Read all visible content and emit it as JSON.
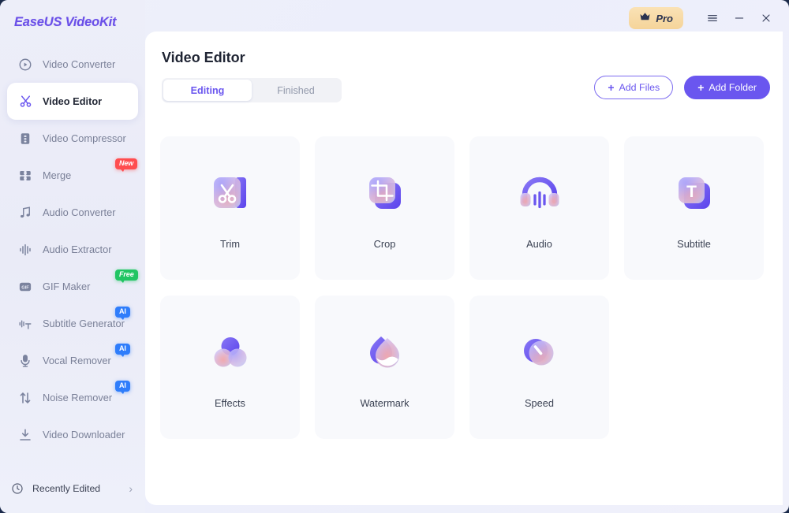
{
  "app": {
    "logo": "EaseUS VideoKit"
  },
  "titlebar": {
    "pro_label": "Pro",
    "crown_icon": "crown-icon",
    "menu_icon": "hamburger-menu-icon",
    "minimize_icon": "minimize-icon",
    "close_icon": "close-icon"
  },
  "sidebar": {
    "items": [
      {
        "label": "Video Converter",
        "icon": "play-circle-icon",
        "active": false,
        "badge": null
      },
      {
        "label": "Video Editor",
        "icon": "scissors-icon",
        "active": true,
        "badge": null
      },
      {
        "label": "Video Compressor",
        "icon": "compress-icon",
        "active": false,
        "badge": null
      },
      {
        "label": "Merge",
        "icon": "merge-grid-icon",
        "active": false,
        "badge": {
          "text": "New",
          "color": "#ff4d4f",
          "kind": "new"
        }
      },
      {
        "label": "Audio Converter",
        "icon": "music-note-icon",
        "active": false,
        "badge": null
      },
      {
        "label": "Audio Extractor",
        "icon": "waveform-icon",
        "active": false,
        "badge": null
      },
      {
        "label": "GIF Maker",
        "icon": "gif-icon",
        "active": false,
        "badge": {
          "text": "Free",
          "color": "#21c563",
          "kind": "free"
        }
      },
      {
        "label": "Subtitle Generator",
        "icon": "subtitle-wave-icon",
        "active": false,
        "badge": {
          "text": "AI",
          "color": "#2f7dfb",
          "kind": "ai"
        }
      },
      {
        "label": "Vocal Remover",
        "icon": "microphone-icon",
        "active": false,
        "badge": {
          "text": "AI",
          "color": "#2f7dfb",
          "kind": "ai"
        }
      },
      {
        "label": "Noise Remover",
        "icon": "arrows-updown-icon",
        "active": false,
        "badge": {
          "text": "AI",
          "color": "#2f7dfb",
          "kind": "ai"
        }
      },
      {
        "label": "Video Downloader",
        "icon": "download-icon",
        "active": false,
        "badge": null
      }
    ],
    "footer": {
      "label": "Recently Edited",
      "icon": "clock-icon",
      "chevron": "›"
    }
  },
  "main": {
    "title": "Video Editor",
    "tabs": [
      {
        "label": "Editing",
        "active": true
      },
      {
        "label": "Finished",
        "active": false
      }
    ],
    "buttons": [
      {
        "label": "Add Files",
        "style": "outline",
        "icon": "plus-icon"
      },
      {
        "label": "Add Folder",
        "style": "filled",
        "icon": "plus-icon"
      }
    ],
    "cards": [
      {
        "label": "Trim",
        "icon": "scissors-tool-icon"
      },
      {
        "label": "Crop",
        "icon": "crop-tool-icon"
      },
      {
        "label": "Audio",
        "icon": "headphones-tool-icon"
      },
      {
        "label": "Subtitle",
        "icon": "subtitle-t-tool-icon"
      },
      {
        "label": "Effects",
        "icon": "effects-circles-tool-icon"
      },
      {
        "label": "Watermark",
        "icon": "watermark-droplet-tool-icon"
      },
      {
        "label": "Speed",
        "icon": "speed-dial-tool-icon"
      }
    ]
  },
  "colors": {
    "accent": "#6a56ef",
    "logo": "#6a4fe8",
    "badge_new": "#ff4d4f",
    "badge_free": "#21c563",
    "badge_ai": "#2f7dfb",
    "pro_gold": "#f5d49a",
    "card_bg": "#f8f9fc"
  }
}
